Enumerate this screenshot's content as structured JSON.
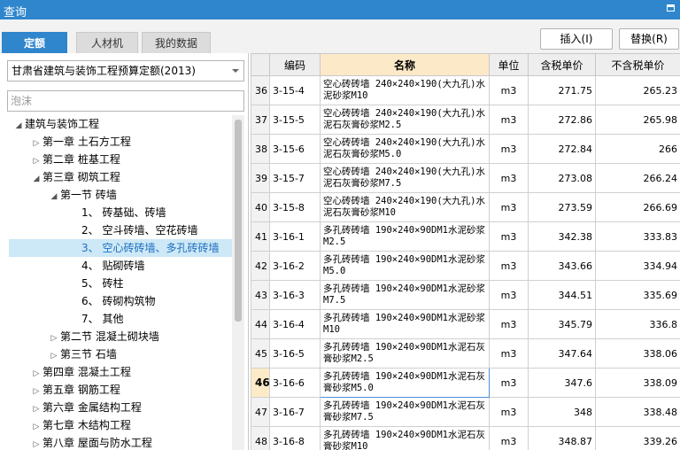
{
  "window": {
    "title": "查询"
  },
  "tabs": [
    {
      "label": "定额",
      "active": true
    },
    {
      "label": "人材机",
      "active": false
    },
    {
      "label": "我的数据",
      "active": false
    }
  ],
  "actions": {
    "insert": "插入(I)",
    "replace": "替换(R)"
  },
  "library": {
    "selected": "甘肃省建筑与装饰工程预算定额(2013)"
  },
  "search": {
    "placeholder": "泡沫"
  },
  "tree": [
    {
      "label": "建筑与装饰工程",
      "expanded": true
    },
    {
      "label": "第一章 土石方工程",
      "expanded": false
    },
    {
      "label": "第二章 桩基工程",
      "expanded": false
    },
    {
      "label": "第三章 砌筑工程",
      "expanded": true
    },
    {
      "label": "第一节 砖墙",
      "expanded": true
    },
    {
      "label": "1、 砖基础、砖墙"
    },
    {
      "label": "2、 空斗砖墙、空花砖墙"
    },
    {
      "label": "3、 空心砖砖墙、多孔砖砖墙",
      "selected": true
    },
    {
      "label": "4、 贴砌砖墙"
    },
    {
      "label": "5、 砖柱"
    },
    {
      "label": "6、 砖砌构筑物"
    },
    {
      "label": "7、 其他"
    },
    {
      "label": "第二节 混凝土砌块墙",
      "expanded": false
    },
    {
      "label": "第三节 石墙",
      "expanded": false
    },
    {
      "label": "第四章 混凝土工程",
      "expanded": false
    },
    {
      "label": "第五章 钢筋工程",
      "expanded": false
    },
    {
      "label": "第六章 金属结构工程",
      "expanded": false
    },
    {
      "label": "第七章 木结构工程",
      "expanded": false
    },
    {
      "label": "第八章 屋面与防水工程",
      "expanded": false
    }
  ],
  "table": {
    "columns": [
      "",
      "编码",
      "名称",
      "单位",
      "含税单价",
      "不含税单价"
    ],
    "sorted_column": "名称",
    "rows": [
      {
        "n": "36",
        "code": "3-15-4",
        "name": "空心砖砖墙 240×240×190(大九孔)水泥砂浆M10",
        "unit": "m3",
        "price_tax": "271.75",
        "price_notax": "265.23"
      },
      {
        "n": "37",
        "code": "3-15-5",
        "name": "空心砖砖墙 240×240×190(大九孔)水泥石灰膏砂浆M2.5",
        "unit": "m3",
        "price_tax": "272.86",
        "price_notax": "265.98"
      },
      {
        "n": "38",
        "code": "3-15-6",
        "name": "空心砖砖墙 240×240×190(大九孔)水泥石灰膏砂浆M5.0",
        "unit": "m3",
        "price_tax": "272.84",
        "price_notax": "266"
      },
      {
        "n": "39",
        "code": "3-15-7",
        "name": "空心砖砖墙 240×240×190(大九孔)水泥石灰膏砂浆M7.5",
        "unit": "m3",
        "price_tax": "273.08",
        "price_notax": "266.24"
      },
      {
        "n": "40",
        "code": "3-15-8",
        "name": "空心砖砖墙 240×240×190(大九孔)水泥石灰膏砂浆M10",
        "unit": "m3",
        "price_tax": "273.59",
        "price_notax": "266.69"
      },
      {
        "n": "41",
        "code": "3-16-1",
        "name": "多孔砖砖墙 190×240×90DM1水泥砂浆M2.5",
        "unit": "m3",
        "price_tax": "342.38",
        "price_notax": "333.83"
      },
      {
        "n": "42",
        "code": "3-16-2",
        "name": "多孔砖砖墙 190×240×90DM1水泥砂浆M5.0",
        "unit": "m3",
        "price_tax": "343.66",
        "price_notax": "334.94"
      },
      {
        "n": "43",
        "code": "3-16-3",
        "name": "多孔砖砖墙 190×240×90DM1水泥砂浆M7.5",
        "unit": "m3",
        "price_tax": "344.51",
        "price_notax": "335.69"
      },
      {
        "n": "44",
        "code": "3-16-4",
        "name": "多孔砖砖墙 190×240×90DM1水泥砂浆M10",
        "unit": "m3",
        "price_tax": "345.79",
        "price_notax": "336.8"
      },
      {
        "n": "45",
        "code": "3-16-5",
        "name": "多孔砖砖墙 190×240×90DM1水泥石灰膏砂浆M2.5",
        "unit": "m3",
        "price_tax": "347.64",
        "price_notax": "338.06"
      },
      {
        "n": "46",
        "code": "3-16-6",
        "name": "多孔砖砖墙 190×240×90DM1水泥石灰膏砂浆M5.0",
        "unit": "m3",
        "price_tax": "347.6",
        "price_notax": "338.09",
        "current": true
      },
      {
        "n": "47",
        "code": "3-16-7",
        "name": "多孔砖砖墙 190×240×90DM1水泥石灰膏砂浆M7.5",
        "unit": "m3",
        "price_tax": "348",
        "price_notax": "338.48"
      },
      {
        "n": "48",
        "code": "3-16-8",
        "name": "多孔砖砖墙 190×240×90DM1水泥石灰膏砂浆M10",
        "unit": "m3",
        "price_tax": "348.87",
        "price_notax": "339.26"
      }
    ]
  },
  "colors": {
    "accent": "#2f86cc",
    "selection": "#cde8f6",
    "header_sorted": "#fce9c8"
  }
}
